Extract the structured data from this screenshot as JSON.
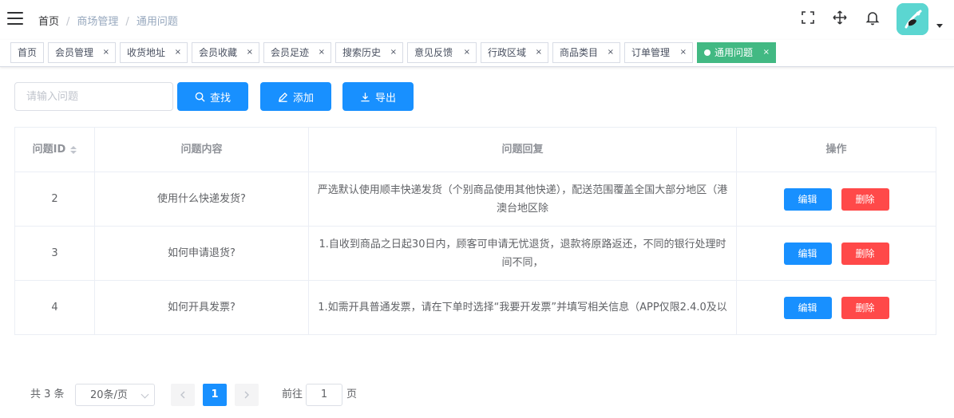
{
  "header": {
    "breadcrumb": [
      "首页",
      "商场管理",
      "通用问题"
    ],
    "breadcrumb_separator": "/"
  },
  "tags": [
    {
      "label": "首页",
      "closable": false
    },
    {
      "label": "会员管理",
      "closable": true
    },
    {
      "label": "收货地址",
      "closable": true
    },
    {
      "label": "会员收藏",
      "closable": true
    },
    {
      "label": "会员足迹",
      "closable": true
    },
    {
      "label": "搜索历史",
      "closable": true
    },
    {
      "label": "意见反馈",
      "closable": true
    },
    {
      "label": "行政区域",
      "closable": true
    },
    {
      "label": "商品类目",
      "closable": true
    },
    {
      "label": "订单管理",
      "closable": true
    },
    {
      "label": "通用问题",
      "closable": true,
      "active": true
    }
  ],
  "tag_close_glyph": "×",
  "toolbar": {
    "search_placeholder": "请输入问题",
    "search_value": "",
    "search_label": "查找",
    "add_label": "添加",
    "export_label": "导出"
  },
  "table": {
    "columns": [
      "问题ID",
      "问题内容",
      "问题回复",
      "操作"
    ],
    "rows": [
      {
        "id": "2",
        "question": "使用什么快递发货?",
        "answer": "严选默认使用顺丰快递发货（个别商品使用其他快递），配送范围覆盖全国大部分地区（港澳台地区除"
      },
      {
        "id": "3",
        "question": "如何申请退货?",
        "answer": "1.自收到商品之日起30日内，顾客可申请无忧退货，退款将原路返还，不同的银行处理时间不同，"
      },
      {
        "id": "4",
        "question": "如何开具发票?",
        "answer": "1.如需开具普通发票，请在下单时选择“我要开发票”并填写相关信息（APP仅限2.4.0及以"
      }
    ],
    "edit_label": "编辑",
    "delete_label": "删除"
  },
  "pagination": {
    "total_text": "共 3 条",
    "page_size": "20条/页",
    "current_page": "1",
    "goto_prefix": "前往",
    "goto_value": "1",
    "goto_suffix": "页"
  },
  "colors": {
    "primary": "#1890ff",
    "danger": "#ff4949",
    "active_tag": "#42b983",
    "avatar_bg": "#5bd6d1"
  },
  "icons": {
    "menu": "hamburger-icon",
    "fullscreen": "fullscreen-icon",
    "size": "move-icon",
    "notifications": "bell-icon"
  }
}
